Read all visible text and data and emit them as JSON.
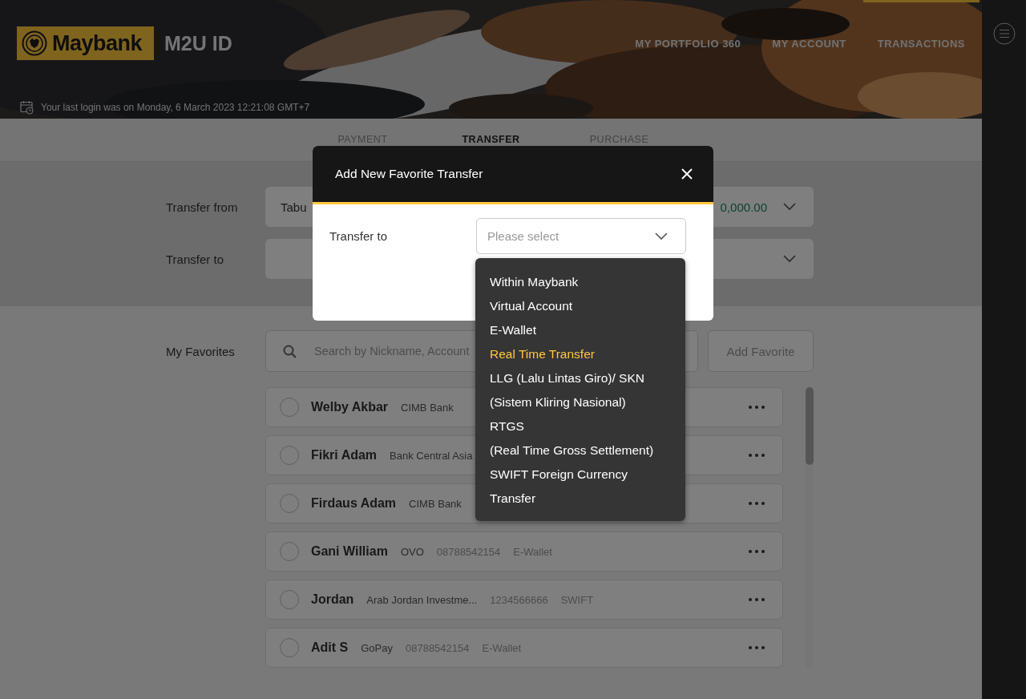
{
  "header": {
    "logo": "Maybank",
    "product": "M2U ID",
    "last_login": "Your last login was on Monday, 6 March 2023 12:21:08 GMT+7",
    "nav": [
      {
        "label": "MY PORTFOLIO 360",
        "selected": false
      },
      {
        "label": "MY ACCOUNT",
        "selected": false
      },
      {
        "label": "TRANSACTIONS",
        "selected": true
      }
    ]
  },
  "tabs": [
    {
      "label": "PAYMENT",
      "selected": false
    },
    {
      "label": "TRANSFER",
      "selected": true
    },
    {
      "label": "PURCHASE",
      "selected": false
    }
  ],
  "form": [
    {
      "label": "Transfer from",
      "value": "Tabu",
      "amount": "0,000.00"
    },
    {
      "label": "Transfer to"
    }
  ],
  "favorites": {
    "label": "My Favorites",
    "search_placeholder": "Search by Nickname, Account",
    "add_button": "Add Favorite",
    "rows": [
      {
        "name": "Welby Akbar",
        "bank": "CIMB Bank",
        "checked": false
      },
      {
        "name": "Fikri Adam",
        "bank": "Bank Central Asia",
        "checked": false
      },
      {
        "name": "Firdaus Adam",
        "bank": "CIMB Bank",
        "checked": false
      },
      {
        "name": "Gani William",
        "bank": "OVO",
        "account": "08788542154",
        "type": "E-Wallet",
        "checked": false
      },
      {
        "name": "Jordan",
        "bank": "Arab Jordan Investme...",
        "account": "1234566666",
        "type": "SWIFT",
        "checked": false
      },
      {
        "name": "Adit S",
        "bank": "GoPay",
        "account": "08788542154",
        "type": "E-Wallet",
        "checked": false
      }
    ]
  },
  "modal": {
    "title": "Add New Favorite Transfer",
    "field_label": "Transfer to",
    "placeholder": "Please select",
    "options": [
      {
        "lines": [
          "Within Maybank"
        ],
        "selected": false
      },
      {
        "lines": [
          "Virtual Account"
        ],
        "selected": false
      },
      {
        "lines": [
          "E-Wallet"
        ],
        "selected": false
      },
      {
        "lines": [
          "Real Time Transfer"
        ],
        "selected": true
      },
      {
        "lines": [
          "LLG (Lalu Lintas Giro)/ SKN",
          "(Sistem Kliring Nasional)"
        ],
        "selected": false
      },
      {
        "lines": [
          "RTGS",
          "(Real Time Gross Settlement)"
        ],
        "selected": false
      },
      {
        "lines": [
          "SWIFT Foreign Currency",
          "Transfer"
        ],
        "selected": false
      }
    ]
  }
}
